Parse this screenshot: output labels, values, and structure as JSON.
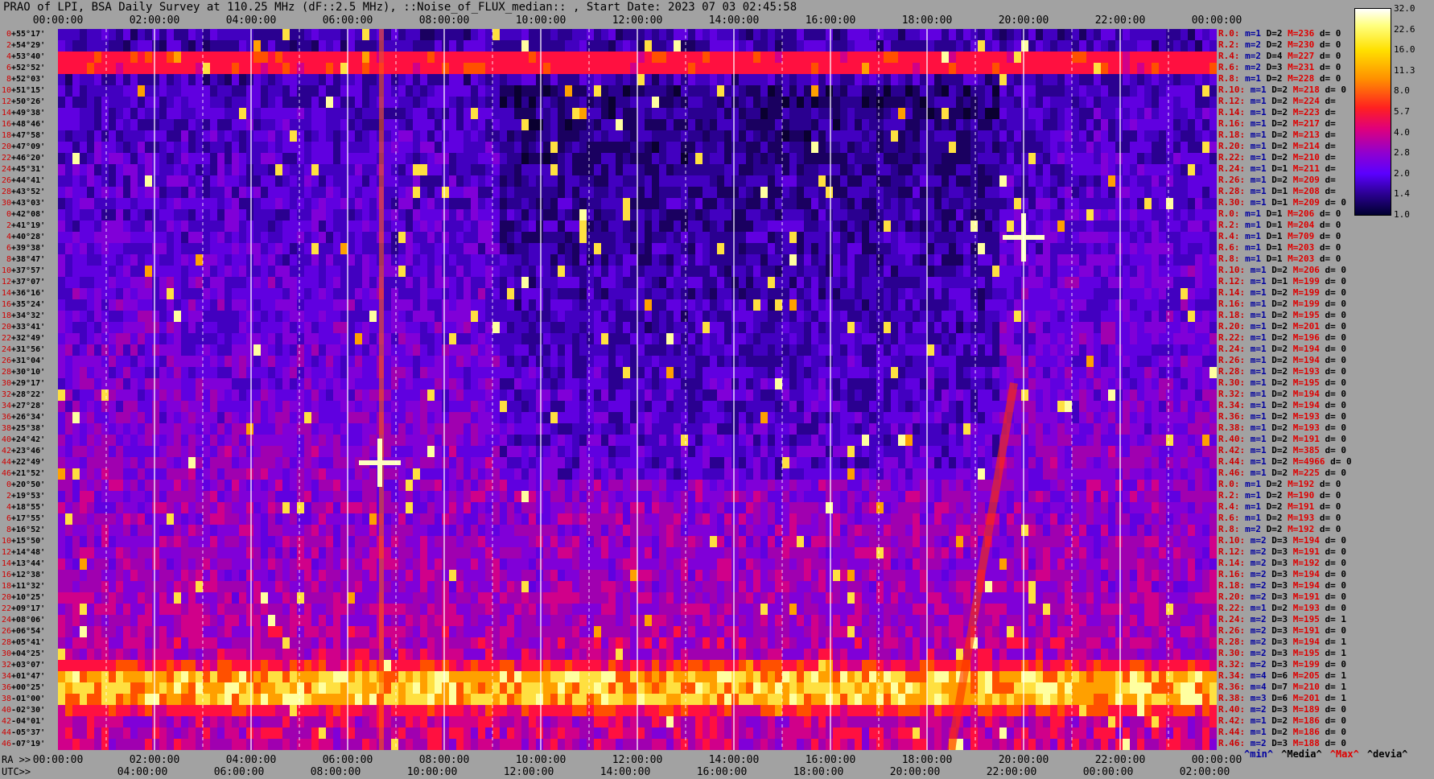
{
  "title": "PRAO of LPI, BSA Daily Survey at 110.25 MHz (dF::2.5 MHz), ::Noise_of_FLUX_median:: , Start Date: 2023 07 03 02:45:58",
  "chart_data": {
    "type": "heatmap",
    "title": "PRAO of LPI, BSA Daily Survey at 110.25 MHz (dF::2.5 MHz), ::Noise_of_FLUX_median:: , Start Date: 2023 07 03 02:45:58",
    "x_top_ticks": [
      "00:00:00",
      "02:00:00",
      "04:00:00",
      "06:00:00",
      "08:00:00",
      "10:00:00",
      "12:00:00",
      "14:00:00",
      "16:00:00",
      "18:00:00",
      "20:00:00",
      "22:00:00",
      "00:00:00"
    ],
    "ra_prefix": "RA >>",
    "ra_ticks": [
      "00:00:00",
      "02:00:00",
      "04:00:00",
      "06:00:00",
      "08:00:00",
      "10:00:00",
      "12:00:00",
      "14:00:00",
      "16:00:00",
      "18:00:00",
      "20:00:00",
      "22:00:00",
      "00:00:00"
    ],
    "utc_prefix": "UTC>>",
    "utc_ticks": [
      "04:00:00",
      "06:00:00",
      "08:00:00",
      "10:00:00",
      "12:00:00",
      "14:00:00",
      "16:00:00",
      "18:00:00",
      "20:00:00",
      "22:00:00",
      "00:00:00",
      "02:00:00"
    ],
    "declinations": [
      "+55°17'",
      "+54°29'",
      "+53°40'",
      "+52°52'",
      "+52°03'",
      "+51°15'",
      "+50°26'",
      "+49°38'",
      "+48°46'",
      "+47°58'",
      "+47°09'",
      "+46°20'",
      "+45°31'",
      "+44°41'",
      "+43°52'",
      "+43°03'",
      "+42°08'",
      "+41°19'",
      "+40°28'",
      "+39°38'",
      "+38°47'",
      "+37°57'",
      "+37°07'",
      "+36°16'",
      "+35°24'",
      "+34°32'",
      "+33°41'",
      "+32°49'",
      "+31°56'",
      "+31°04'",
      "+30°10'",
      "+29°17'",
      "+28°22'",
      "+27°28'",
      "+26°34'",
      "+25°38'",
      "+24°42'",
      "+23°46'",
      "+22°49'",
      "+21°52'",
      "+20°50'",
      "+19°53'",
      "+18°55'",
      "+17°55'",
      "+16°52'",
      "+15°50'",
      "+14°48'",
      "+13°44'",
      "+12°38'",
      "+11°32'",
      "+10°25'",
      "+09°17'",
      "+08°06'",
      "+06°54'",
      "+05°41'",
      "+04°25'",
      "+03°07'",
      "+01°47'",
      "+00°25'",
      "-01°00'",
      "-02°30'",
      "-04°01'",
      "-05°37'",
      "-07°19'"
    ],
    "dec_indices": [
      "0",
      "2",
      "4",
      "6",
      "8",
      "10",
      "12",
      "14",
      "16",
      "18",
      "20",
      "22",
      "24",
      "26",
      "28",
      "30",
      "0",
      "2",
      "4",
      "6",
      "8",
      "10",
      "12",
      "14",
      "16",
      "18",
      "20",
      "22",
      "24",
      "26",
      "28",
      "30",
      "32",
      "34",
      "36",
      "38",
      "40",
      "42",
      "44",
      "46",
      "0",
      "2",
      "4",
      "6",
      "8",
      "10",
      "12",
      "14",
      "16",
      "18",
      "20",
      "22",
      "24",
      "26",
      "28",
      "30",
      "32",
      "34",
      "36",
      "38",
      "40",
      "42",
      "44",
      "46"
    ],
    "stats": [
      {
        "ray": "R.0:",
        "m": "m=1",
        "d": "D=2",
        "max": "M=236",
        "dev": "d= 0"
      },
      {
        "ray": "R.2:",
        "m": "m=2",
        "d": "D=2",
        "max": "M=230",
        "dev": "d= 0"
      },
      {
        "ray": "R.4:",
        "m": "m=2",
        "d": "D=4",
        "max": "M=227",
        "dev": "d= 0"
      },
      {
        "ray": "R.6:",
        "m": "m=2",
        "d": "D=3",
        "max": "M=231",
        "dev": "d= 0"
      },
      {
        "ray": "R.8:",
        "m": "m=1",
        "d": "D=2",
        "max": "M=228",
        "dev": "d= 0"
      },
      {
        "ray": "R.10:",
        "m": "m=1",
        "d": "D=2",
        "max": "M=218",
        "dev": "d= 0"
      },
      {
        "ray": "R.12:",
        "m": "m=1",
        "d": "D=2",
        "max": "M=224",
        "dev": "d="
      },
      {
        "ray": "R.14:",
        "m": "m=1",
        "d": "D=2",
        "max": "M=223",
        "dev": "d="
      },
      {
        "ray": "R.16:",
        "m": "m=1",
        "d": "D=2",
        "max": "M=217",
        "dev": "d="
      },
      {
        "ray": "R.18:",
        "m": "m=1",
        "d": "D=2",
        "max": "M=213",
        "dev": "d="
      },
      {
        "ray": "R.20:",
        "m": "m=1",
        "d": "D=2",
        "max": "M=214",
        "dev": "d="
      },
      {
        "ray": "R.22:",
        "m": "m=1",
        "d": "D=2",
        "max": "M=210",
        "dev": "d="
      },
      {
        "ray": "R.24:",
        "m": "m=1",
        "d": "D=1",
        "max": "M=211",
        "dev": "d="
      },
      {
        "ray": "R.26:",
        "m": "m=1",
        "d": "D=2",
        "max": "M=209",
        "dev": "d="
      },
      {
        "ray": "R.28:",
        "m": "m=1",
        "d": "D=1",
        "max": "M=208",
        "dev": "d="
      },
      {
        "ray": "R.30:",
        "m": "m=1",
        "d": "D=1",
        "max": "M=209",
        "dev": "d= 0"
      },
      {
        "ray": "R.0:",
        "m": "m=1",
        "d": "D=1",
        "max": "M=206",
        "dev": "d= 0"
      },
      {
        "ray": "R.2:",
        "m": "m=1",
        "d": "D=1",
        "max": "M=204",
        "dev": "d= 0"
      },
      {
        "ray": "R.4:",
        "m": "m=1",
        "d": "D=1",
        "max": "M=709",
        "dev": "d= 0"
      },
      {
        "ray": "R.6:",
        "m": "m=1",
        "d": "D=1",
        "max": "M=203",
        "dev": "d= 0"
      },
      {
        "ray": "R.8:",
        "m": "m=1",
        "d": "D=1",
        "max": "M=203",
        "dev": "d= 0"
      },
      {
        "ray": "R.10:",
        "m": "m=1",
        "d": "D=2",
        "max": "M=206",
        "dev": "d= 0"
      },
      {
        "ray": "R.12:",
        "m": "m=1",
        "d": "D=1",
        "max": "M=199",
        "dev": "d= 0"
      },
      {
        "ray": "R.14:",
        "m": "m=1",
        "d": "D=2",
        "max": "M=199",
        "dev": "d= 0"
      },
      {
        "ray": "R.16:",
        "m": "m=1",
        "d": "D=2",
        "max": "M=199",
        "dev": "d= 0"
      },
      {
        "ray": "R.18:",
        "m": "m=1",
        "d": "D=2",
        "max": "M=195",
        "dev": "d= 0"
      },
      {
        "ray": "R.20:",
        "m": "m=1",
        "d": "D=2",
        "max": "M=201",
        "dev": "d= 0"
      },
      {
        "ray": "R.22:",
        "m": "m=1",
        "d": "D=2",
        "max": "M=196",
        "dev": "d= 0"
      },
      {
        "ray": "R.24:",
        "m": "m=1",
        "d": "D=2",
        "max": "M=194",
        "dev": "d= 0"
      },
      {
        "ray": "R.26:",
        "m": "m=1",
        "d": "D=2",
        "max": "M=194",
        "dev": "d= 0"
      },
      {
        "ray": "R.28:",
        "m": "m=1",
        "d": "D=2",
        "max": "M=193",
        "dev": "d= 0"
      },
      {
        "ray": "R.30:",
        "m": "m=1",
        "d": "D=2",
        "max": "M=195",
        "dev": "d= 0"
      },
      {
        "ray": "R.32:",
        "m": "m=1",
        "d": "D=2",
        "max": "M=194",
        "dev": "d= 0"
      },
      {
        "ray": "R.34:",
        "m": "m=1",
        "d": "D=2",
        "max": "M=194",
        "dev": "d= 0"
      },
      {
        "ray": "R.36:",
        "m": "m=1",
        "d": "D=2",
        "max": "M=193",
        "dev": "d= 0"
      },
      {
        "ray": "R.38:",
        "m": "m=1",
        "d": "D=2",
        "max": "M=193",
        "dev": "d= 0"
      },
      {
        "ray": "R.40:",
        "m": "m=1",
        "d": "D=2",
        "max": "M=191",
        "dev": "d= 0"
      },
      {
        "ray": "R.42:",
        "m": "m=1",
        "d": "D=2",
        "max": "M=385",
        "dev": "d= 0"
      },
      {
        "ray": "R.44:",
        "m": "m=1",
        "d": "D=2",
        "max": "M=4966",
        "dev": "d= 0"
      },
      {
        "ray": "R.46:",
        "m": "m=1",
        "d": "D=2",
        "max": "M=225",
        "dev": "d= 0"
      },
      {
        "ray": "R.0:",
        "m": "m=1",
        "d": "D=2",
        "max": "M=192",
        "dev": "d= 0"
      },
      {
        "ray": "R.2:",
        "m": "m=1",
        "d": "D=2",
        "max": "M=190",
        "dev": "d= 0"
      },
      {
        "ray": "R.4:",
        "m": "m=1",
        "d": "D=2",
        "max": "M=191",
        "dev": "d= 0"
      },
      {
        "ray": "R.6:",
        "m": "m=1",
        "d": "D=2",
        "max": "M=193",
        "dev": "d= 0"
      },
      {
        "ray": "R.8:",
        "m": "m=2",
        "d": "D=2",
        "max": "M=192",
        "dev": "d= 0"
      },
      {
        "ray": "R.10:",
        "m": "m=2",
        "d": "D=3",
        "max": "M=194",
        "dev": "d= 0"
      },
      {
        "ray": "R.12:",
        "m": "m=2",
        "d": "D=3",
        "max": "M=191",
        "dev": "d= 0"
      },
      {
        "ray": "R.14:",
        "m": "m=2",
        "d": "D=3",
        "max": "M=192",
        "dev": "d= 0"
      },
      {
        "ray": "R.16:",
        "m": "m=2",
        "d": "D=3",
        "max": "M=194",
        "dev": "d= 0"
      },
      {
        "ray": "R.18:",
        "m": "m=2",
        "d": "D=3",
        "max": "M=194",
        "dev": "d= 0"
      },
      {
        "ray": "R.20:",
        "m": "m=2",
        "d": "D=3",
        "max": "M=191",
        "dev": "d= 0"
      },
      {
        "ray": "R.22:",
        "m": "m=1",
        "d": "D=2",
        "max": "M=193",
        "dev": "d= 0"
      },
      {
        "ray": "R.24:",
        "m": "m=2",
        "d": "D=3",
        "max": "M=195",
        "dev": "d= 1"
      },
      {
        "ray": "R.26:",
        "m": "m=2",
        "d": "D=3",
        "max": "M=191",
        "dev": "d= 0"
      },
      {
        "ray": "R.28:",
        "m": "m=2",
        "d": "D=3",
        "max": "M=194",
        "dev": "d= 1"
      },
      {
        "ray": "R.30:",
        "m": "m=2",
        "d": "D=3",
        "max": "M=195",
        "dev": "d= 1"
      },
      {
        "ray": "R.32:",
        "m": "m=2",
        "d": "D=3",
        "max": "M=199",
        "dev": "d= 0"
      },
      {
        "ray": "R.34:",
        "m": "m=4",
        "d": "D=6",
        "max": "M=205",
        "dev": "d= 1"
      },
      {
        "ray": "R.36:",
        "m": "m=4",
        "d": "D=7",
        "max": "M=210",
        "dev": "d= 1"
      },
      {
        "ray": "R.38:",
        "m": "m=3",
        "d": "D=6",
        "max": "M=201",
        "dev": "d= 1"
      },
      {
        "ray": "R.40:",
        "m": "m=2",
        "d": "D=3",
        "max": "M=189",
        "dev": "d= 0"
      },
      {
        "ray": "R.42:",
        "m": "m=1",
        "d": "D=2",
        "max": "M=186",
        "dev": "d= 0"
      },
      {
        "ray": "R.44:",
        "m": "m=1",
        "d": "D=2",
        "max": "M=186",
        "dev": "d= 0"
      },
      {
        "ray": "R.46:",
        "m": "m=2",
        "d": "D=3",
        "max": "M=188",
        "dev": "d= 0"
      }
    ],
    "colorbar": {
      "ticks": [
        "32.0",
        "22.6",
        "16.0",
        "11.3",
        "8.0",
        "5.7",
        "4.0",
        "2.8",
        "2.0",
        "1.4",
        "1.0"
      ],
      "scale": "log",
      "range": [
        1.0,
        32.0
      ]
    },
    "legend_footer": [
      "^min^",
      "^Media^",
      "^Max^",
      "^devia^"
    ],
    "colors": {
      "background": "#a2a2a2",
      "low": "#1a0060",
      "mid": "#9000d0",
      "high": "#ff2020",
      "peak": "#ffff80",
      "ray_label": "#d00000",
      "max_label": "#e00000",
      "m_label": "#0000a0"
    },
    "features": {
      "bright_band_dec": "+00°25'",
      "bright_band_rows": [
        57,
        58,
        59
      ],
      "top_bright_band_rows": [
        2,
        3
      ],
      "point_sources": [
        {
          "ra": "06:40",
          "dec_row": 38,
          "label": "strong source"
        },
        {
          "ra": "20:00",
          "dec_row": 18,
          "label": "strong source"
        }
      ]
    }
  }
}
